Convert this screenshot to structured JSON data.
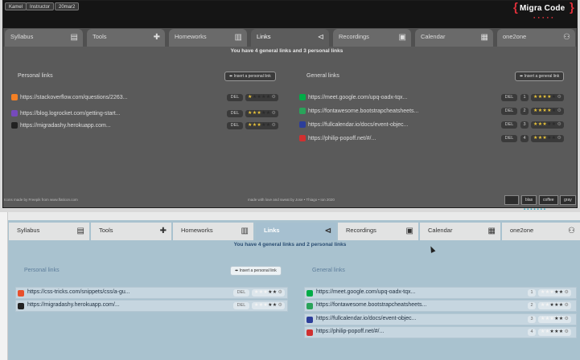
{
  "top_window": {
    "header": {
      "buttons": [
        "Kamel",
        "Instructor",
        "20mar2"
      ],
      "logo": "Migra Code",
      "logo_dots": "● ● ● ● ●"
    },
    "tabs": [
      {
        "label": "Syllabus",
        "icon": "document-icon",
        "glyph": "▤"
      },
      {
        "label": "Tools",
        "icon": "tools-icon",
        "glyph": "✚"
      },
      {
        "label": "Homeworks",
        "icon": "notebook-icon",
        "glyph": "▥"
      },
      {
        "label": "Links",
        "icon": "share-icon",
        "glyph": "⊲"
      },
      {
        "label": "Recordings",
        "icon": "film-icon",
        "glyph": "▣"
      },
      {
        "label": "Calendar",
        "icon": "calendar-icon",
        "glyph": "▦"
      },
      {
        "label": "one2one",
        "icon": "users-icon",
        "glyph": "⚇"
      }
    ],
    "summary": "You have 4 general links and 3 personal links",
    "personal": {
      "title": "Personal links",
      "insert_button": "⬌ Insert a personal link",
      "items": [
        {
          "text": "https://stackoverflow.com/questions/2263...",
          "rating": 1,
          "icon": "stackoverflow-icon",
          "color": "#f48024"
        },
        {
          "text": "https://blog.logrocket.com/getting-start...",
          "rating": 3,
          "icon": "logrocket-icon",
          "color": "#764abc"
        },
        {
          "text": "https://migradashy.herokuapp.com...",
          "rating": 3,
          "icon": "heroku-icon",
          "color": "#222222"
        }
      ]
    },
    "general": {
      "title": "General links",
      "insert_button": "⬌ Insert a general link",
      "items": [
        {
          "text": "https://meet.google.com/upq-oadx-tqx...",
          "num": "1",
          "rating": 4,
          "icon": "google-meet-icon",
          "color": "#00ac47"
        },
        {
          "text": "https://fontawesome.bootstrapcheatsheets...",
          "num": "2",
          "rating": 4,
          "icon": "fontawesome-icon",
          "color": "#2aa35a"
        },
        {
          "text": "https://fullcalendar.io/docs/event-objec...",
          "num": "3",
          "rating": 3,
          "icon": "fullcalendar-icon",
          "color": "#2c3e9a"
        },
        {
          "text": "https://philip-popoff.net/#/...",
          "num": "4",
          "rating": 3,
          "icon": "location-pin-icon",
          "color": "#d03030"
        }
      ]
    },
    "del_label": "DEL",
    "footer_left": "Icons made by Freepik from www.flaticon.com",
    "footer_center": "made with love and sweat by Jose • Thiago • Ion 2020",
    "footer_buttons": [
      "",
      "blas",
      "coffee",
      "gray"
    ]
  },
  "bottom_window": {
    "tabs": [
      {
        "label": "Syllabus",
        "icon": "document-icon",
        "glyph": "▤"
      },
      {
        "label": "Tools",
        "icon": "tools-icon",
        "glyph": "✚"
      },
      {
        "label": "Homeworks",
        "icon": "notebook-icon",
        "glyph": "▥"
      },
      {
        "label": "Links",
        "icon": "share-icon",
        "glyph": "⊲"
      },
      {
        "label": "Recordings",
        "icon": "film-icon",
        "glyph": "▣"
      },
      {
        "label": "Calendar",
        "icon": "calendar-icon",
        "glyph": "▦"
      },
      {
        "label": "one2one",
        "icon": "users-icon",
        "glyph": "⚇"
      }
    ],
    "summary": "You have 4 general links and 2 personal links",
    "personal": {
      "title": "Personal links",
      "insert_button": "⬌ Insert a personal link",
      "items": [
        {
          "text": "https://css-tricks.com/snippets/css/a-gu...",
          "rating": 3,
          "icon": "css-tricks-icon",
          "color": "#e8502c"
        },
        {
          "text": "https://migradashy.herokuapp.com/...",
          "rating": 3,
          "icon": "heroku-icon",
          "color": "#222222"
        }
      ]
    },
    "general": {
      "title": "General links",
      "items": [
        {
          "text": "https://meet.google.com/upq-oadx-tqx...",
          "num": "1",
          "rating": 3,
          "icon": "google-meet-icon",
          "color": "#00ac47"
        },
        {
          "text": "https://fontawesome.bootstrapcheatsheets...",
          "num": "2",
          "rating": 2,
          "icon": "fontawesome-icon",
          "color": "#2aa35a"
        },
        {
          "text": "https://fullcalendar.io/docs/event-objec...",
          "num": "3",
          "rating": 3,
          "icon": "fullcalendar-icon",
          "color": "#2c3e9a"
        },
        {
          "text": "https://philip-popoff.net/#/...",
          "num": "4",
          "rating": 2,
          "icon": "location-pin-icon",
          "color": "#d03030"
        }
      ]
    },
    "del_label": "DEL"
  },
  "colors": {
    "accent_red": "#e0303a",
    "star": "#e8c33a",
    "summary_blue": "#2a4d72"
  }
}
